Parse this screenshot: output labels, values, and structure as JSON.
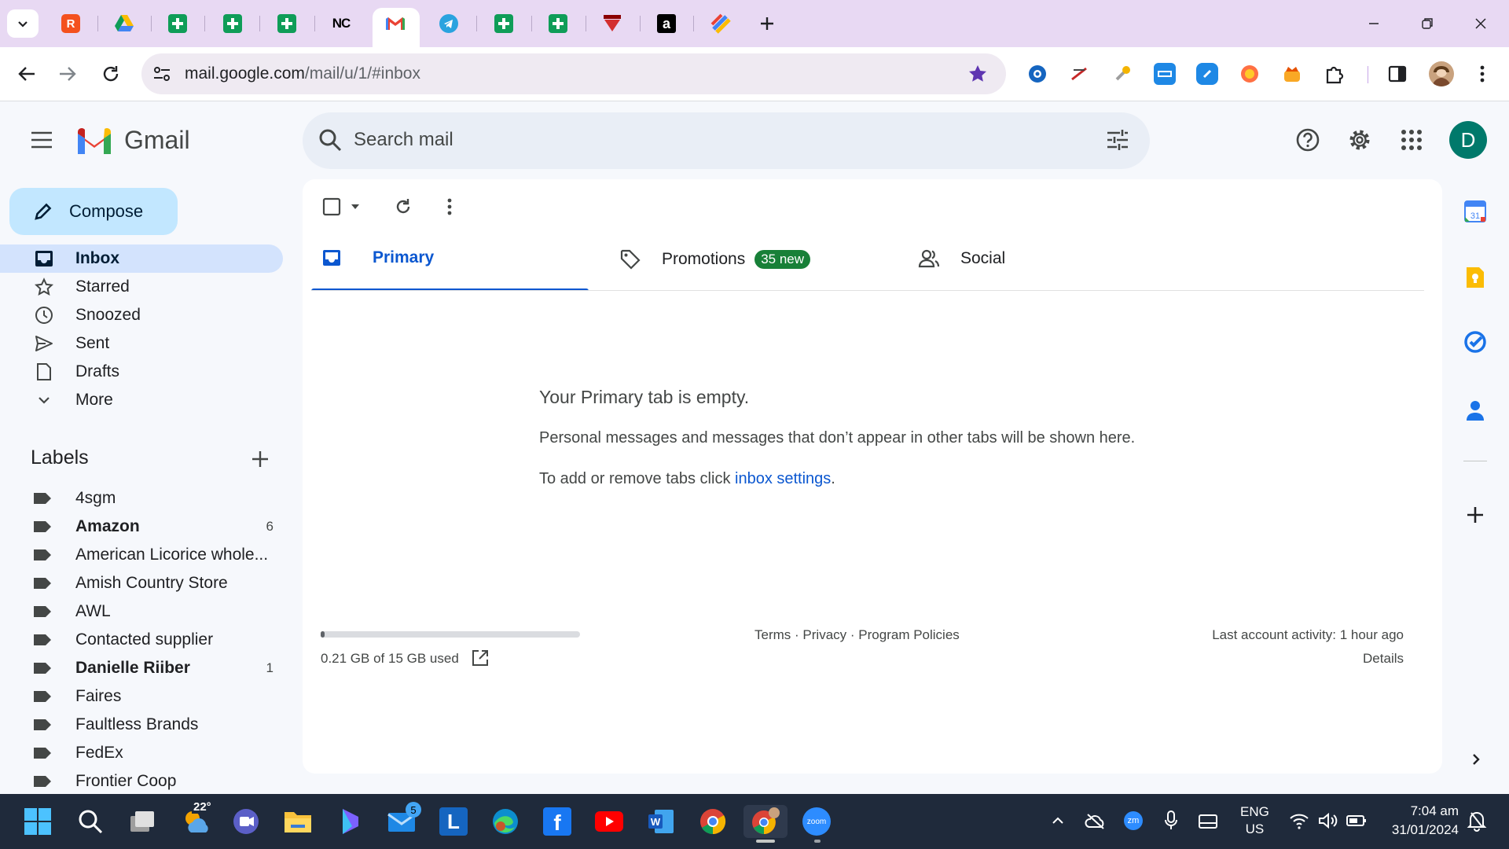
{
  "browser": {
    "url_host": "mail.google.com",
    "url_path": "/mail/u/1/#inbox",
    "tabs": [
      {
        "icon": "tab-search-icon"
      },
      {
        "icon": "r-app-icon"
      },
      {
        "icon": "google-drive-icon"
      },
      {
        "icon": "google-sheets-icon"
      },
      {
        "icon": "google-sheets-icon"
      },
      {
        "icon": "google-sheets-icon"
      },
      {
        "icon": "nc-icon",
        "text": "NC"
      },
      {
        "icon": "gmail-icon",
        "active": true
      },
      {
        "icon": "telegram-icon"
      },
      {
        "icon": "google-sheets-icon"
      },
      {
        "icon": "google-sheets-icon"
      },
      {
        "icon": "red-triangle-icon"
      },
      {
        "icon": "amazon-icon",
        "text": "a"
      },
      {
        "icon": "multicolor-app-icon"
      }
    ],
    "extensions": [
      "ext-blue-circle",
      "ext-login",
      "ext-wrench",
      "ext-fba",
      "ext-link",
      "ext-orange",
      "ext-crown",
      "ext-puzzle",
      "ext-sidebar"
    ],
    "colors": {
      "tabstrip": "#e8d9f3",
      "omnibox": "#efeaf2"
    }
  },
  "gmail": {
    "brand": "Gmail",
    "search_placeholder": "Search mail",
    "account_initial": "D",
    "compose": "Compose",
    "nav": [
      {
        "label": "Inbox",
        "icon": "inbox-icon",
        "active": true
      },
      {
        "label": "Starred",
        "icon": "star-icon"
      },
      {
        "label": "Snoozed",
        "icon": "clock-icon"
      },
      {
        "label": "Sent",
        "icon": "send-icon"
      },
      {
        "label": "Drafts",
        "icon": "draft-icon"
      },
      {
        "label": "More",
        "icon": "chevron-down-icon"
      }
    ],
    "labels_heading": "Labels",
    "labels": [
      {
        "name": "4sgm",
        "count": ""
      },
      {
        "name": "Amazon",
        "count": "6",
        "bold": true
      },
      {
        "name": "American Licorice whole...",
        "count": ""
      },
      {
        "name": "Amish Country Store",
        "count": ""
      },
      {
        "name": "AWL",
        "count": ""
      },
      {
        "name": "Contacted supplier",
        "count": ""
      },
      {
        "name": "Danielle Riiber",
        "count": "1",
        "bold": true
      },
      {
        "name": "Faires",
        "count": ""
      },
      {
        "name": "Faultless Brands",
        "count": ""
      },
      {
        "name": "FedEx",
        "count": ""
      },
      {
        "name": "Frontier Coop",
        "count": ""
      }
    ],
    "tabs": [
      {
        "label": "Primary",
        "icon": "inbox-icon",
        "active": true
      },
      {
        "label": "Promotions",
        "icon": "tag-icon",
        "badge": "35 new"
      },
      {
        "label": "Social",
        "icon": "people-icon"
      }
    ],
    "empty_title": "Your Primary tab is empty.",
    "empty_desc": "Personal messages and messages that don’t appear in other tabs will be shown here.",
    "empty_link_prefix": "To add or remove tabs click ",
    "empty_link": "inbox settings",
    "empty_link_suffix": ".",
    "storage_text": "0.21 GB of 15 GB used",
    "storage_used_fraction": 0.014,
    "footer_terms": "Terms",
    "footer_privacy": "Privacy",
    "footer_policies": "Program Policies",
    "footer_sep": "·",
    "last_activity": "Last account activity: 1 hour ago",
    "details": "Details",
    "side_apps": [
      "calendar-icon",
      "keep-icon",
      "tasks-icon",
      "contacts-icon"
    ],
    "colors": {
      "accent": "#0b57d0",
      "compose": "#c2e7ff",
      "badge": "#188038",
      "avatar": "#00796b"
    }
  },
  "taskbar": {
    "weather_temp": "22°",
    "mail_badge": "5",
    "zoom_label": "zoom",
    "lang_top": "ENG",
    "lang_bottom": "US",
    "time": "7:04 am",
    "date": "31/01/2024"
  }
}
